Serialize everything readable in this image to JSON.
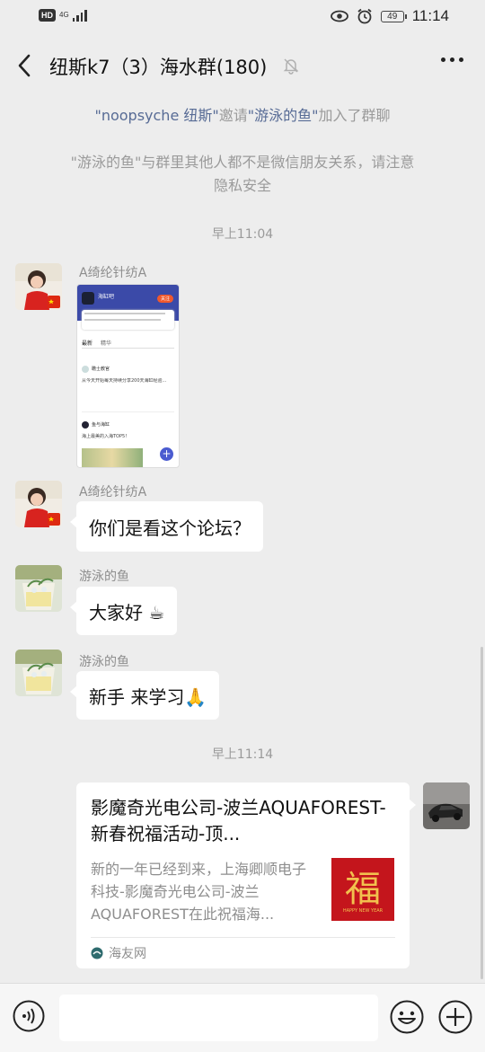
{
  "status": {
    "hd_badge": "HD",
    "network_type": "4G",
    "battery": "49",
    "time": "11:14"
  },
  "header": {
    "title": "纽斯k7（3）海水群(180)"
  },
  "system_messages": {
    "invite": {
      "inviter": "\"noopsyche 纽斯\"",
      "verb": "邀请",
      "invitee": "\"游泳的鱼\"",
      "suffix": "加入了群聊"
    },
    "privacy_line1": "\"游泳的鱼\"与群里其他人都不是微信朋友关系，请注意",
    "privacy_line2": "隐私安全"
  },
  "timestamps": [
    "早上11:04",
    "早上11:14"
  ],
  "messages": [
    {
      "sender": "A绮纶针纺A",
      "type": "image"
    },
    {
      "sender": "A绮纶针纺A",
      "text": "你们是看这个论坛？"
    },
    {
      "sender": "游泳的鱼",
      "text": "大家好 ☕"
    },
    {
      "sender": "游泳的鱼",
      "text": "新手 来学习🙏"
    }
  ],
  "image_preview": {
    "forum_name": "海缸吧",
    "follow": "关注",
    "tab_latest": "最新",
    "tab_hot": "精华",
    "post_author": "瞻士教官",
    "post_text": "从今天开始每天持续分享200天海缸经验...",
    "second_author": "鱼与海缸",
    "second_text": "海上最美的入海TOP5！"
  },
  "link_card": {
    "title": "影魔奇光电公司-波兰AQUAFOREST-新春祝福活动-顶...",
    "description": "新的一年已经到来，上海卿顺电子科技-影魔奇光电公司-波兰AQUAFOREST在此祝福海...",
    "thumb_char": "福",
    "thumb_caption": "HAPPY NEW YEAR",
    "source": "海友网"
  },
  "icons": [
    "back-icon",
    "mute-bell-icon",
    "more-icon",
    "voice-icon",
    "emoji-icon",
    "plus-icon",
    "eye-icon",
    "alarm-icon",
    "signal-icon",
    "battery-icon"
  ],
  "colors": {
    "background": "#ededed",
    "link_name": "#576b95",
    "system_text": "#9a9a9a"
  }
}
